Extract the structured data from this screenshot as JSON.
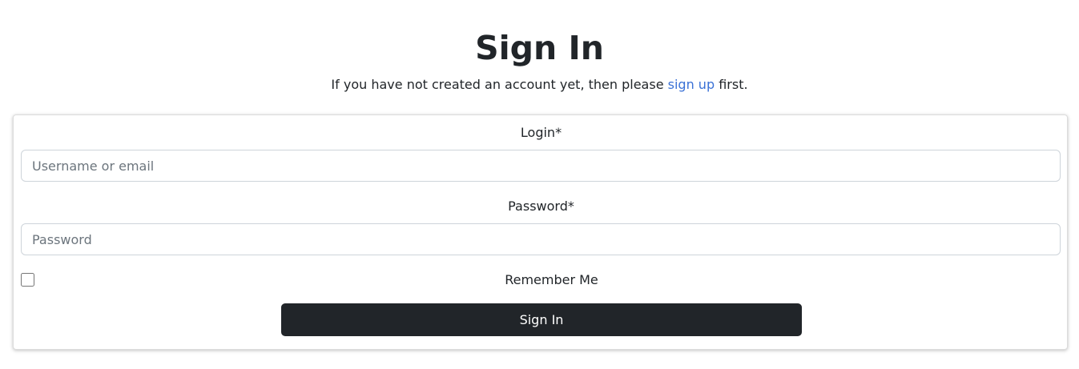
{
  "header": {
    "title": "Sign In",
    "subtitle_before": "If you have not created an account yet, then please",
    "signup_link": "sign up",
    "subtitle_after": "first."
  },
  "form": {
    "login_label": "Login*",
    "login_placeholder": "Username or email",
    "login_value": "",
    "password_label": "Password*",
    "password_placeholder": "Password",
    "password_value": "",
    "remember_label": "Remember Me",
    "remember_checked": false,
    "submit_label": "Sign In"
  },
  "colors": {
    "link": "#3a71d6",
    "button_bg": "#212529",
    "button_text": "#ffffff",
    "text": "#212529"
  }
}
